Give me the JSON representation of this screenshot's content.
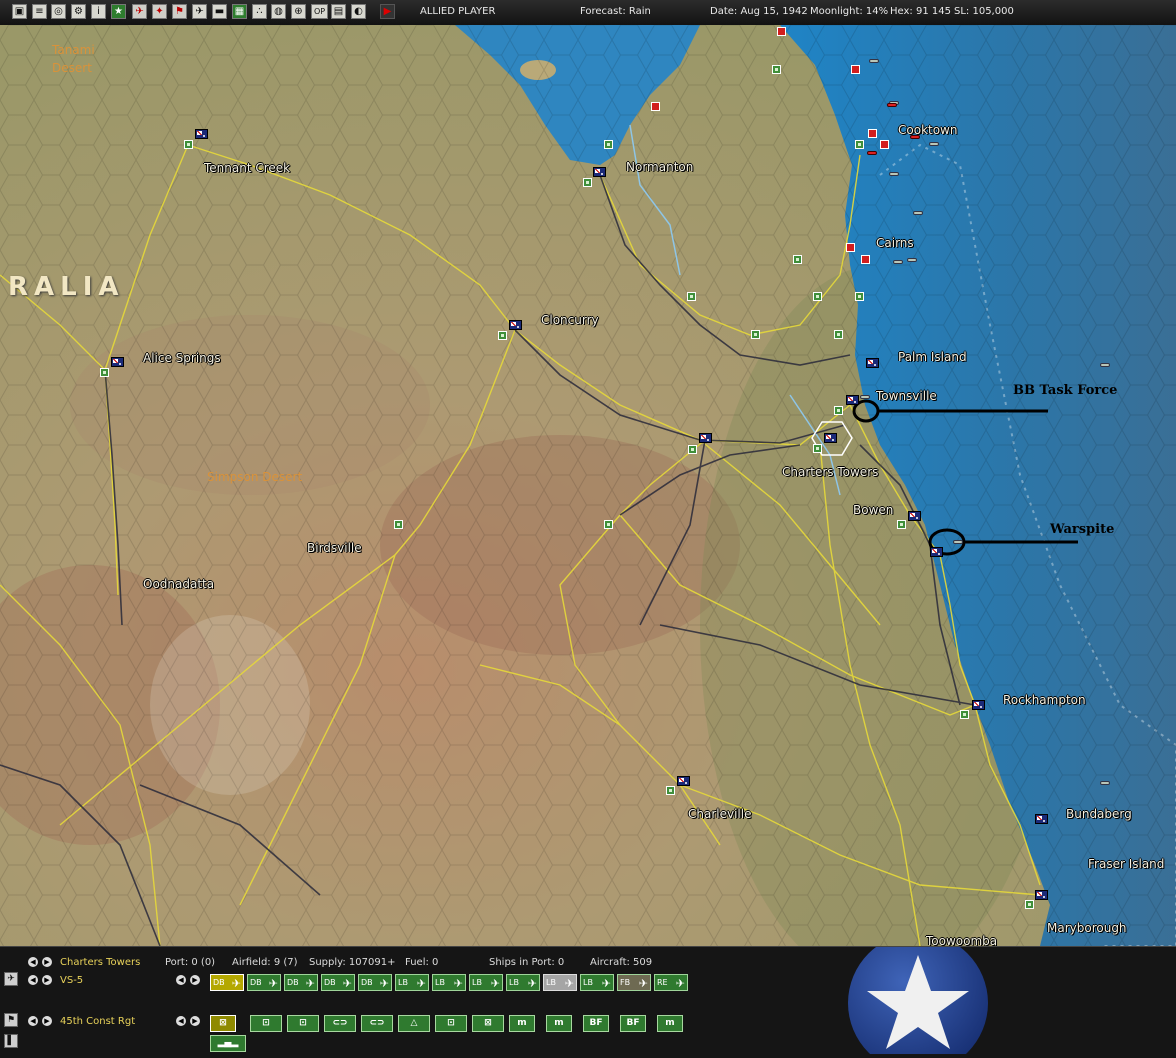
{
  "toolbar": {
    "icons": [
      "save-icon",
      "list-icon",
      "replay-icon",
      "settings-icon",
      "info-icon",
      "star-icon",
      "aircraft-icon",
      "ship-icon",
      "flag-icon",
      "plane-icon",
      "map-icon",
      "group-icon",
      "globe-icon",
      "target-icon",
      "op-icon",
      "report-icon",
      "end-icon",
      "play-icon"
    ],
    "op_label": "OP",
    "side": "ALLIED PLAYER",
    "forecast": "Forecast: Rain",
    "date": "Date: Aug 15, 1942",
    "moonlight": "Moonlight: 14%",
    "hex": "Hex: 91 145",
    "sl": "SL: 105,000"
  },
  "map": {
    "region": "RALIA",
    "deserts": {
      "tanami1": "Tanami",
      "tanami2": "Desert",
      "simpson": "Simpson Desert"
    },
    "cities": {
      "tennant_creek": "Tennant Creek",
      "alice_springs": "Alice Springs",
      "normanton": "Normanton",
      "cloncurry": "Cloncurry",
      "cooktown": "Cooktown",
      "cairns": "Cairns",
      "palm_island": "Palm Island",
      "townsville": "Townsville",
      "charters_towers": "Charters Towers",
      "bowen": "Bowen",
      "birdsville": "Birdsville",
      "oodnadatta": "Oodnadatta",
      "rockhampton": "Rockhampton",
      "charleville": "Charleville",
      "bundaberg": "Bundaberg",
      "fraser_island": "Fraser Island",
      "maryborough": "Maryborough",
      "toowoomba": "Toowoomba"
    },
    "annotations": {
      "bb_task_force": "BB Task Force",
      "warspite": "Warspite"
    },
    "colors": {
      "sea": "#2e86bf",
      "land": "#a39e72",
      "road": "#e6d93a",
      "rail": "#2a2a3a",
      "allied_base": "#3f8f3a",
      "japan_base": "#d21e1e"
    }
  },
  "panel": {
    "base_name": "Charters Towers",
    "port": "Port: 0 (0)",
    "airfield": "Airfield: 9 (7)",
    "supply": "Supply: 107091+",
    "fuel": "Fuel: 0",
    "ships": "Ships in Port: 0",
    "aircraft": "Aircraft: 509",
    "air_unit": "VS-5",
    "land_unit": "45th Const Rgt",
    "air_buttons": [
      "DB",
      "DB",
      "DB",
      "DB",
      "DB",
      "LB",
      "LB",
      "LB",
      "LB",
      "LB",
      "LB",
      "FB",
      "RE"
    ],
    "land_buttons": [
      "hq-icon",
      "inf-icon",
      "inf-icon",
      "armor-icon",
      "armor-icon",
      "eng-icon",
      "inf-icon",
      "cross-icon"
    ],
    "land_text_buttons": [
      "m",
      "m",
      "BF",
      "BF",
      "m"
    ],
    "colors": {
      "nation_blue": "#1f3f8f",
      "button_green": "#2f7a2f"
    }
  }
}
